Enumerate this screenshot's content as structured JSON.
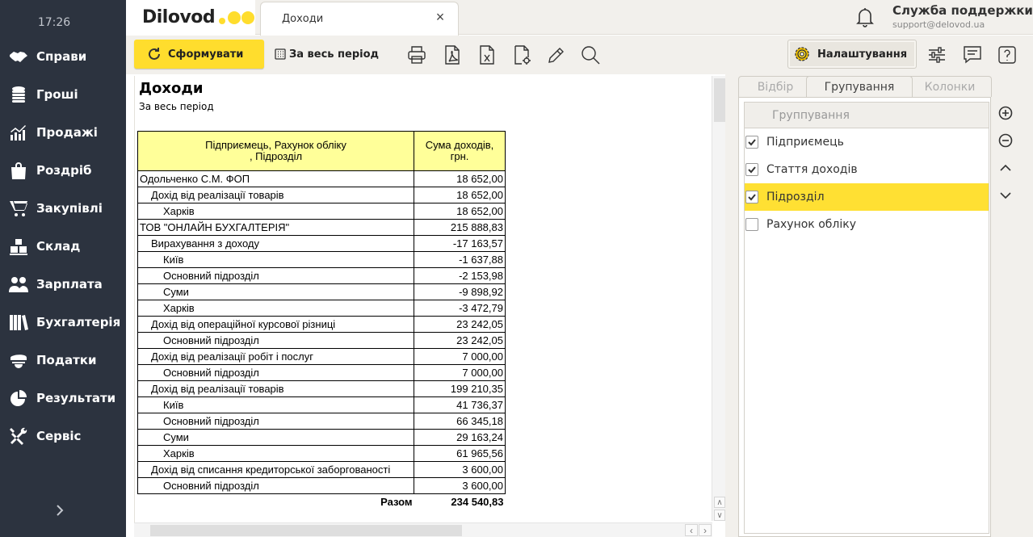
{
  "sidebar": {
    "time": "17:26",
    "items": [
      {
        "label": "Справи",
        "icon": "handshake-icon"
      },
      {
        "label": "Гроші",
        "icon": "coins-icon"
      },
      {
        "label": "Продажі",
        "icon": "chart-up-icon"
      },
      {
        "label": "Роздріб",
        "icon": "shopping-bag-icon"
      },
      {
        "label": "Закупівлі",
        "icon": "cart-icon"
      },
      {
        "label": "Склад",
        "icon": "boxes-icon"
      },
      {
        "label": "Зарплата",
        "icon": "people-icon"
      },
      {
        "label": "Бухгалтерія",
        "icon": "books-icon"
      },
      {
        "label": "Податки",
        "icon": "officer-cap-icon"
      },
      {
        "label": "Результати",
        "icon": "pie-chart-icon"
      },
      {
        "label": "Сервіс",
        "icon": "tools-icon"
      }
    ]
  },
  "header": {
    "logo": "Dilovod",
    "tab_title": "Доходи",
    "tab_close": "×",
    "support_title": "Служба поддержки",
    "support_email": "support@delovod.ua"
  },
  "toolbar": {
    "form_label": "Сформувати",
    "period_label": "За весь період",
    "settings_label": "Налаштування"
  },
  "report": {
    "title": "Доходи",
    "subtitle": "За весь період",
    "col1_line1": "Підприємець, Рахунок обліку",
    "col1_line2": ", Підрозділ",
    "col2_line1": "Сума доходів,",
    "col2_line2": "грн.",
    "rows": [
      {
        "level": 0,
        "name": "Одольченко С.М. ФОП",
        "value": "18 652,00"
      },
      {
        "level": 1,
        "name": "Дохід від реалізації товарів",
        "value": "18 652,00"
      },
      {
        "level": 2,
        "name": "Харків",
        "value": "18 652,00"
      },
      {
        "level": 0,
        "name": "ТОВ \"ОНЛАЙН БУХГАЛТЕРІЯ\"",
        "value": "215 888,83"
      },
      {
        "level": 1,
        "name": "Вирахування з доходу",
        "value": "-17 163,57"
      },
      {
        "level": 2,
        "name": "Київ",
        "value": "-1 637,88"
      },
      {
        "level": 2,
        "name": "Основний підрозділ",
        "value": "-2 153,98"
      },
      {
        "level": 2,
        "name": "Суми",
        "value": "-9 898,92"
      },
      {
        "level": 2,
        "name": "Харків",
        "value": "-3 472,79"
      },
      {
        "level": 1,
        "name": "Дохід від операційної курсової різниці",
        "value": "23 242,05"
      },
      {
        "level": 2,
        "name": "Основний підрозділ",
        "value": "23 242,05"
      },
      {
        "level": 1,
        "name": "Дохід від реалізації робіт і послуг",
        "value": "7 000,00"
      },
      {
        "level": 2,
        "name": "Основний підрозділ",
        "value": "7 000,00"
      },
      {
        "level": 1,
        "name": "Дохід від реалізації товарів",
        "value": "199 210,35"
      },
      {
        "level": 2,
        "name": "Київ",
        "value": "41 736,37"
      },
      {
        "level": 2,
        "name": "Основний підрозділ",
        "value": "66 345,18"
      },
      {
        "level": 2,
        "name": "Суми",
        "value": "29 163,24"
      },
      {
        "level": 2,
        "name": "Харків",
        "value": "61 965,56"
      },
      {
        "level": 1,
        "name": "Дохід від списання кредиторської заборгованості",
        "value": "3 600,00"
      },
      {
        "level": 2,
        "name": "Основний підрозділ",
        "value": "3 600,00"
      }
    ],
    "total_label": "Разом",
    "total_value": "234 540,83"
  },
  "panel": {
    "tabs": [
      "Відбір",
      "Групування",
      "Колонки"
    ],
    "active_tab": 1,
    "list_header": "Группування",
    "groups": [
      {
        "label": "Підприємець",
        "checked": true,
        "selected": false
      },
      {
        "label": "Стаття доходів",
        "checked": true,
        "selected": false
      },
      {
        "label": "Підрозділ",
        "checked": true,
        "selected": true
      },
      {
        "label": "Рахунок обліку",
        "checked": false,
        "selected": false
      }
    ]
  },
  "colors": {
    "accent": "#ffdd2d",
    "sidebar": "#2c333f",
    "table_header": "#ffff99",
    "selected_row": "#ffe033"
  }
}
